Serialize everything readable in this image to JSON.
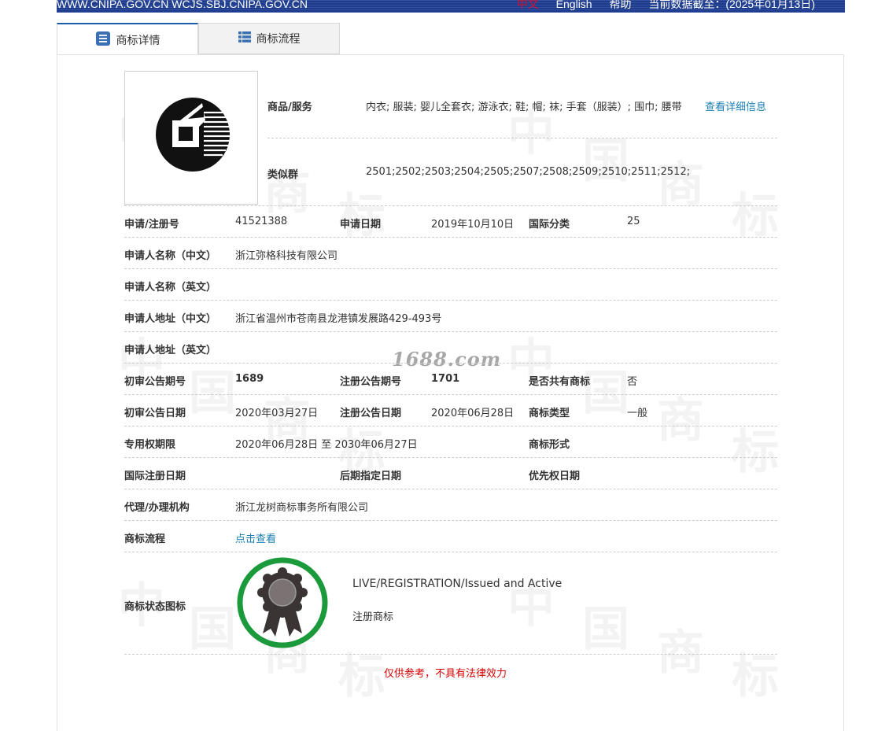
{
  "topbar": {
    "site": "WWW.CNIPA.GOV.CN WCJS.SBJ.CNIPA.GOV.CN",
    "lang_zh": "中文",
    "lang_en": "English",
    "help": "帮助",
    "data_date": "当前数据截至：(2025年01月13日)"
  },
  "tabs": [
    {
      "label": "商标详情",
      "icon": "document-list-icon",
      "active": true
    },
    {
      "label": "商标流程",
      "icon": "list-view-icon",
      "active": false
    }
  ],
  "goods": {
    "label": "商品/服务",
    "value": "内衣; 服装; 婴儿全套衣; 游泳衣; 鞋; 帽; 袜; 手套（服装）; 围巾; 腰带",
    "detail_link": "查看详细信息"
  },
  "similar_group": {
    "label": "类似群",
    "value": "2501;2502;2503;2504;2505;2507;2508;2509;2510;2511;2512;"
  },
  "rows": {
    "reg_no": {
      "label": "申请/注册号",
      "value": "41521388"
    },
    "app_date": {
      "label": "申请日期",
      "value": "2019年10月10日"
    },
    "intl_class": {
      "label": "国际分类",
      "value": "25"
    },
    "applicant_cn": {
      "label": "申请人名称（中文）",
      "value": "浙江弥格科技有限公司"
    },
    "applicant_en": {
      "label": "申请人名称（英文）",
      "value": ""
    },
    "address_cn": {
      "label": "申请人地址（中文）",
      "value": "浙江省温州市苍南县龙港镇发展路429-493号"
    },
    "address_en": {
      "label": "申请人地址（英文）",
      "value": ""
    },
    "prelim_issue": {
      "label": "初审公告期号",
      "value": "1689"
    },
    "reg_issue": {
      "label": "注册公告期号",
      "value": "1701"
    },
    "shared": {
      "label": "是否共有商标",
      "value": "否"
    },
    "prelim_date": {
      "label": "初审公告日期",
      "value": "2020年03月27日"
    },
    "reg_date": {
      "label": "注册公告日期",
      "value": "2020年06月28日"
    },
    "tm_type": {
      "label": "商标类型",
      "value": "一般"
    },
    "term": {
      "label": "专用权期限",
      "value": "2020年06月28日 至 2030年06月27日"
    },
    "tm_form": {
      "label": "商标形式",
      "value": ""
    },
    "intl_reg_date": {
      "label": "国际注册日期",
      "value": ""
    },
    "later_designation": {
      "label": "后期指定日期",
      "value": ""
    },
    "priority_date": {
      "label": "优先权日期",
      "value": ""
    },
    "agency": {
      "label": "代理/办理机构",
      "value": "浙江龙树商标事务所有限公司"
    },
    "process": {
      "label": "商标流程",
      "link": "点击查看"
    }
  },
  "status": {
    "label": "商标状态图标",
    "en": "LIVE/REGISTRATION/Issued and Active",
    "cn": "注册商标",
    "icon": "award-ribbon-icon",
    "ring_color": "#1a9a3a"
  },
  "watermarks": {
    "site_text": "1688.com",
    "tile": [
      "中",
      "国",
      "商",
      "标"
    ]
  },
  "notice": "仅供参考，不具有法律效力",
  "colors": {
    "topbar": "#1d3c8f",
    "link": "#1a7fb6",
    "notice": "#d40000"
  }
}
